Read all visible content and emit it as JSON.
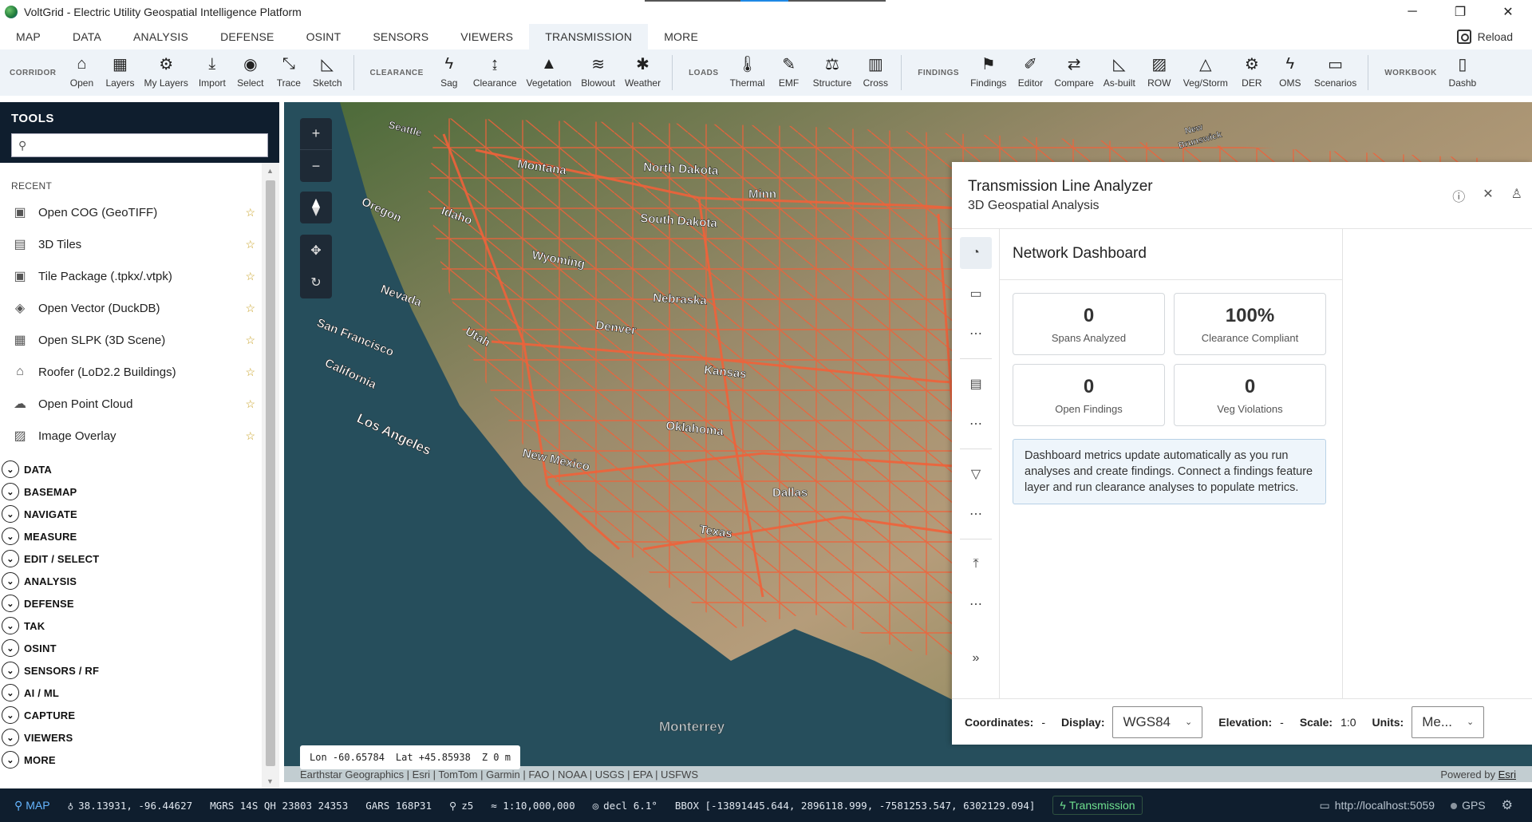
{
  "window": {
    "title": "VoltGrid - Electric Utility Geospatial Intelligence Platform",
    "controls": [
      "─",
      "❐",
      "✕"
    ]
  },
  "menu": {
    "items": [
      "MAP",
      "DATA",
      "ANALYSIS",
      "DEFENSE",
      "OSINT",
      "SENSORS",
      "VIEWERS",
      "TRANSMISSION",
      "MORE"
    ],
    "active": "TRANSMISSION",
    "reload_label": "Reload"
  },
  "ribbon": {
    "groups": [
      {
        "label": "CORRIDOR",
        "buttons": [
          {
            "label": "Open",
            "icon": "house-icon"
          },
          {
            "label": "Layers",
            "icon": "layers-icon"
          },
          {
            "label": "My Layers",
            "icon": "gear-icon"
          },
          {
            "label": "Import",
            "icon": "import-icon"
          },
          {
            "label": "Select",
            "icon": "select-icon"
          },
          {
            "label": "Trace",
            "icon": "trace-icon"
          },
          {
            "label": "Sketch",
            "icon": "sketch-icon"
          }
        ]
      },
      {
        "label": "CLEARANCE",
        "buttons": [
          {
            "label": "Sag",
            "icon": "lightning-icon"
          },
          {
            "label": "Clearance",
            "icon": "clearance-icon"
          },
          {
            "label": "Vegetation",
            "icon": "tree-icon"
          },
          {
            "label": "Blowout",
            "icon": "wind-icon"
          },
          {
            "label": "Weather",
            "icon": "weather-icon"
          }
        ]
      },
      {
        "label": "LOADS",
        "buttons": [
          {
            "label": "Thermal",
            "icon": "thermometer-icon"
          },
          {
            "label": "EMF",
            "icon": "emf-icon"
          },
          {
            "label": "Structure",
            "icon": "scale-icon"
          },
          {
            "label": "Cross",
            "icon": "cross-section-icon"
          }
        ]
      },
      {
        "label": "FINDINGS",
        "buttons": [
          {
            "label": "Findings",
            "icon": "flag-icon"
          },
          {
            "label": "Editor",
            "icon": "pencil-icon"
          },
          {
            "label": "Compare",
            "icon": "compare-icon"
          },
          {
            "label": "As-built",
            "icon": "as-built-icon"
          },
          {
            "label": "ROW",
            "icon": "row-icon"
          },
          {
            "label": "Veg/Storm",
            "icon": "storm-icon"
          },
          {
            "label": "DER",
            "icon": "der-icon"
          },
          {
            "label": "OMS",
            "icon": "oms-icon"
          },
          {
            "label": "Scenarios",
            "icon": "scenarios-icon"
          }
        ]
      },
      {
        "label": "WORKBOOK",
        "buttons": [
          {
            "label": "Dashb",
            "icon": "dashboard-icon"
          }
        ]
      }
    ]
  },
  "tools": {
    "title": "TOOLS",
    "search_placeholder": "",
    "recent_label": "RECENT",
    "recent": [
      {
        "label": "Open COG (GeoTIFF)",
        "icon": "cog-file-icon"
      },
      {
        "label": "3D Tiles",
        "icon": "tiles-3d-icon"
      },
      {
        "label": "Tile Package (.tpkx/.vtpk)",
        "icon": "tile-package-icon"
      },
      {
        "label": "Open Vector (DuckDB)",
        "icon": "vector-icon"
      },
      {
        "label": "Open SLPK (3D Scene)",
        "icon": "slpk-icon"
      },
      {
        "label": "Roofer (LoD2.2 Buildings)",
        "icon": "building-icon"
      },
      {
        "label": "Open Point Cloud",
        "icon": "cloud-icon"
      },
      {
        "label": "Image Overlay",
        "icon": "image-icon"
      }
    ],
    "categories": [
      "DATA",
      "BASEMAP",
      "NAVIGATE",
      "MEASURE",
      "EDIT / SELECT",
      "ANALYSIS",
      "DEFENSE",
      "TAK",
      "OSINT",
      "SENSORS / RF",
      "AI / ML",
      "CAPTURE",
      "VIEWERS",
      "MORE"
    ]
  },
  "map": {
    "coords_box": {
      "lon": "Lon -60.65784",
      "lat": "Lat +45.85938",
      "z": "Z 0 m"
    },
    "labels": [
      "Seattle",
      "Montana",
      "North Dakota",
      "Minn",
      "Oregon",
      "Idaho",
      "South Dakota",
      "Wyoming",
      "Nevada",
      "Nebraska",
      "San Francisco",
      "Utah",
      "Denver",
      "California",
      "Kansas",
      "Los Angeles",
      "Oklahoma",
      "New Mexico",
      "Dallas",
      "Texas",
      "Monterrey",
      "New Brunswick"
    ],
    "attribution": "Earthstar Geographics | Esri | TomTom | Garmin | FAO | NOAA | USGS | EPA | USFWS",
    "powered_prefix": "Powered by",
    "powered_link": "Esri"
  },
  "analyzer": {
    "title": "Transmission Line Analyzer",
    "subtitle": "3D Geospatial Analysis",
    "dashboard_title": "Network Dashboard",
    "metrics": [
      {
        "value": "0",
        "label": "Spans Analyzed"
      },
      {
        "value": "100%",
        "label": "Clearance Compliant"
      },
      {
        "value": "0",
        "label": "Open Findings"
      },
      {
        "value": "0",
        "label": "Veg Violations"
      }
    ],
    "info": "Dashboard metrics update automatically as you run analyses and create findings. Connect a findings feature layer and run clearance analyses to populate metrics.",
    "footer": {
      "coordinates_label": "Coordinates:",
      "coordinates_value": "-",
      "display_label": "Display:",
      "display_value": "WGS84",
      "elevation_label": "Elevation:",
      "elevation_value": "-",
      "scale_label": "Scale:",
      "scale_value": "1:0",
      "units_label": "Units:",
      "units_value": "Me..."
    }
  },
  "status": {
    "mode": "MAP",
    "latlon": "38.13931, -96.44627",
    "mgrs": "MGRS 14S QH 23803 24353",
    "gars": "GARS 168P31",
    "zoom": "z5",
    "scale": "≈ 1:10,000,000",
    "decl": "decl 6.1°",
    "bbox": "BBOX [-13891445.644, 2896118.999, -7581253.547, 6302129.094]",
    "workspace": "Transmission",
    "server": "http://localhost:5059",
    "gps": "GPS"
  },
  "colors": {
    "accent": "#1e88e5",
    "dark": "#0f1e2e",
    "grid_lines": "#f0623a"
  }
}
